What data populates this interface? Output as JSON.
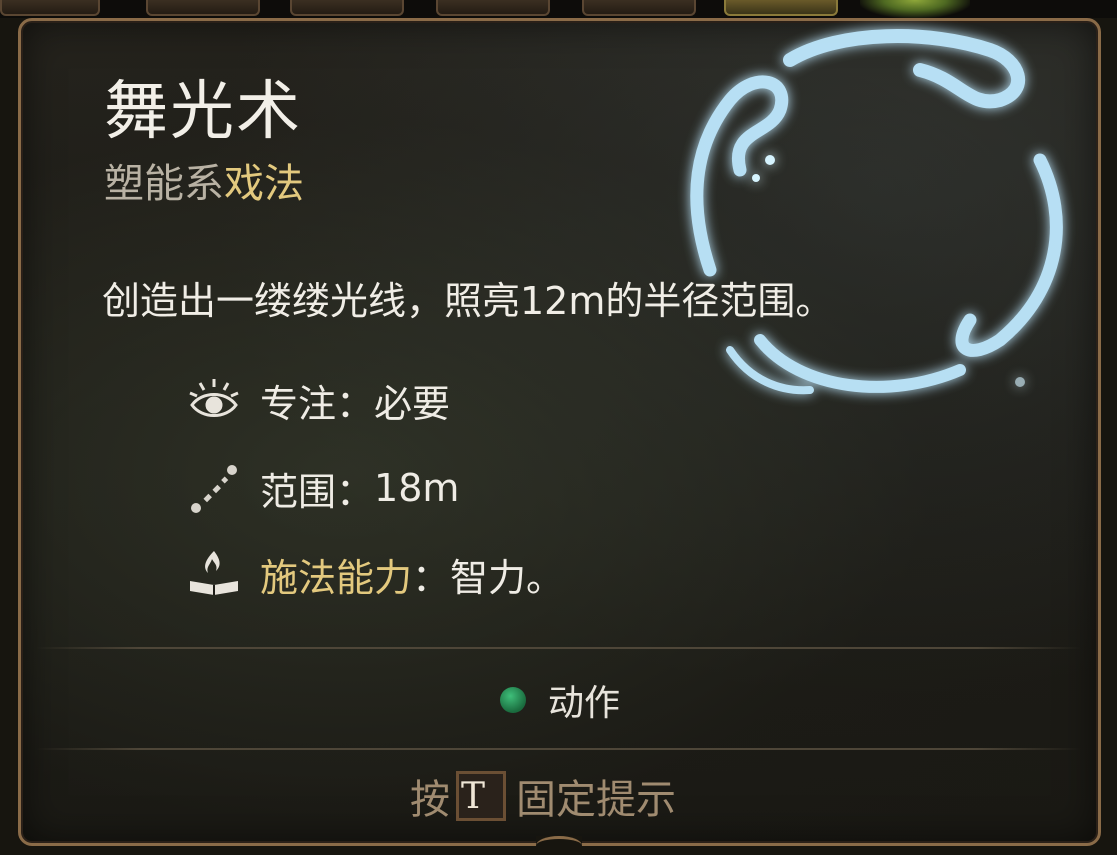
{
  "spell": {
    "name": "舞光术",
    "school": "塑能系",
    "level": "戏法",
    "description": "创造出一缕缕光线，照亮12m的半径范围。"
  },
  "stats": {
    "concentration": {
      "icon": "concentration-eye-icon",
      "label": "专注",
      "sep": "：",
      "value": "必要"
    },
    "range": {
      "icon": "range-icon",
      "label": "范围",
      "sep": "：",
      "value": "18m"
    },
    "ability": {
      "icon": "spellbook-flame-icon",
      "label": "施法能力",
      "sep": "：",
      "value": "智力。"
    }
  },
  "cost": {
    "icon": "action-dot-icon",
    "label": "动作",
    "color": "#2a9a5a"
  },
  "pin_hint": {
    "prefix": "按",
    "key": "T",
    "suffix": "固定提示"
  },
  "colors": {
    "accent_gold": "#e3c97e",
    "frame": "#8a6b48",
    "text": "#f0ede6",
    "muted": "#a08b70"
  }
}
